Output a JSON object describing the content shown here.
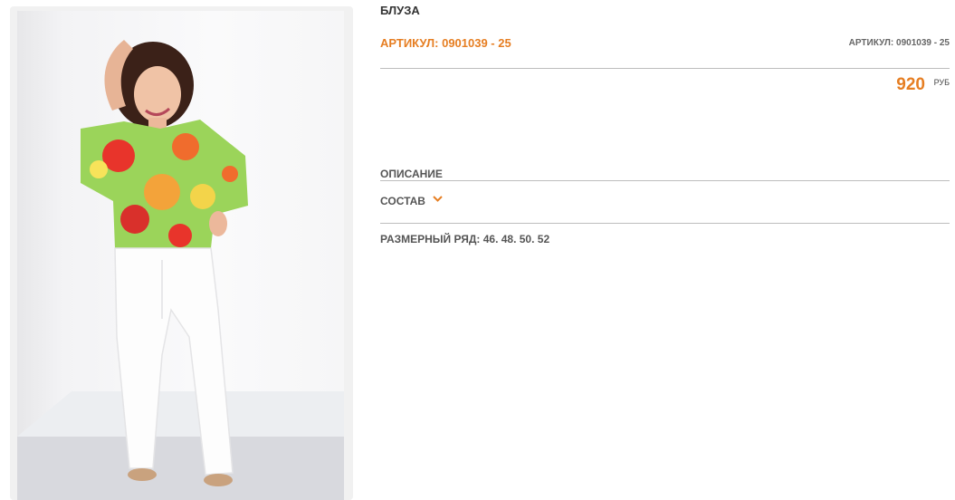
{
  "product": {
    "title": "БЛУЗА",
    "sku_main": "АРТИКУЛ: 0901039 - 25",
    "sku_small": "АРТИКУЛ: 0901039 - 25",
    "price": "920",
    "currency": "РУБ"
  },
  "sections": {
    "description": "ОПИСАНИЕ",
    "composition": "СОСТАВ",
    "size_range": "РАЗМЕРНЫЙ РЯД: 46. 48. 50. 52"
  },
  "colors": {
    "accent": "#e67e22",
    "text": "#555555",
    "rule": "#bdbdbd"
  },
  "icons": {
    "composition_toggle": "chevron-down-icon"
  }
}
